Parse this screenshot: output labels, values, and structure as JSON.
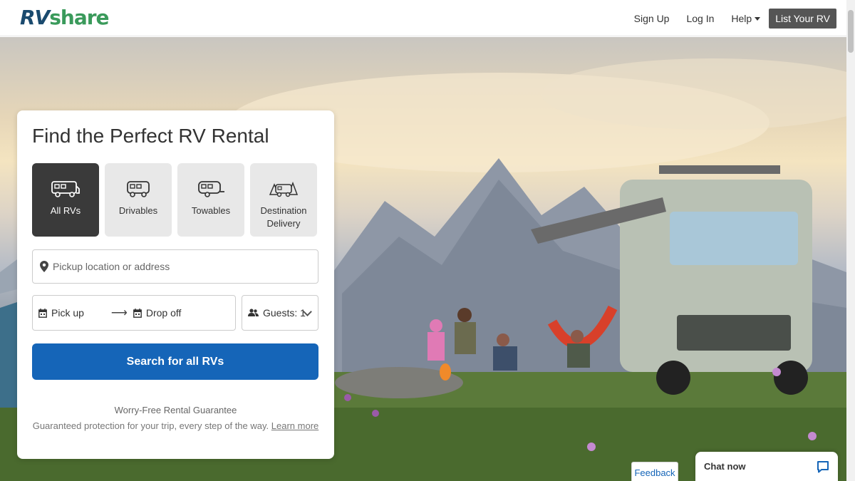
{
  "header": {
    "logo_rv": "RV",
    "logo_share": "share",
    "nav": {
      "sign_up": "Sign Up",
      "log_in": "Log In",
      "help": "Help",
      "list_rv": "List Your RV"
    }
  },
  "search_card": {
    "title": "Find the Perfect RV Rental",
    "types": [
      {
        "label": "All RVs",
        "icon": "all-rvs-icon",
        "active": true
      },
      {
        "label": "Drivables",
        "icon": "drivable-rv-icon",
        "active": false
      },
      {
        "label": "Towables",
        "icon": "towable-trailer-icon",
        "active": false
      },
      {
        "label": "Destination Delivery",
        "icon": "destination-delivery-icon",
        "active": false
      }
    ],
    "location_placeholder": "Pickup location or address",
    "pickup": "Pick up",
    "dropoff": "Drop off",
    "guests": "Guests: 1",
    "search_button": "Search for all RVs",
    "guarantee_title": "Worry-Free Rental Guarantee",
    "guarantee_text": "Guaranteed protection for your trip, every step of the way.",
    "learn_more": "Learn more"
  },
  "feedback": "Feedback",
  "chat": "Chat now",
  "colors": {
    "primary": "#1565b8",
    "active_type": "#3a3a3a",
    "logo_rv": "#1a4a6e",
    "logo_share": "#3a9a5b"
  }
}
